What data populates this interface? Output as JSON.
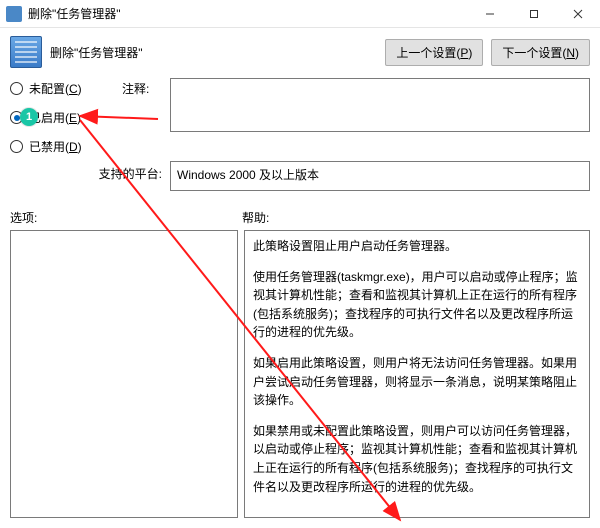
{
  "window": {
    "title": "删除\"任务管理器\""
  },
  "header": {
    "label": "删除\"任务管理器\"",
    "prev_button_prefix": "上一个设置(",
    "prev_button_accel": "P",
    "prev_button_suffix": ")",
    "next_button_prefix": "下一个设置(",
    "next_button_accel": "N",
    "next_button_suffix": ")"
  },
  "radios": {
    "not_configured_prefix": "未配置(",
    "not_configured_accel": "C",
    "not_configured_suffix": ")",
    "enabled_prefix": "已启用(",
    "enabled_accel": "E",
    "enabled_suffix": ")",
    "disabled_prefix": "已禁用(",
    "disabled_accel": "D",
    "disabled_suffix": ")",
    "selected": "enabled"
  },
  "labels": {
    "comment": "注释:",
    "platform": "支持的平台:",
    "options": "选项:",
    "help": "帮助:"
  },
  "platform": {
    "value": "Windows 2000 及以上版本"
  },
  "help": {
    "p1": "此策略设置阻止用户启动任务管理器。",
    "p2": "使用任务管理器(taskmgr.exe)，用户可以启动或停止程序；监视其计算机性能；查看和监视其计算机上正在运行的所有程序(包括系统服务)；查找程序的可执行文件名以及更改程序所运行的进程的优先级。",
    "p3": "如果启用此策略设置，则用户将无法访问任务管理器。如果用户尝试启动任务管理器，则将显示一条消息，说明某策略阻止该操作。",
    "p4": "如果禁用或未配置此策略设置，则用户可以访问任务管理器，以启动或停止程序；监视其计算机性能；查看和监视其计算机上正在运行的所有程序(包括系统服务)；查找程序的可执行文件名以及更改程序所运行的进程的优先级。"
  },
  "annotations": {
    "step1": "1"
  }
}
